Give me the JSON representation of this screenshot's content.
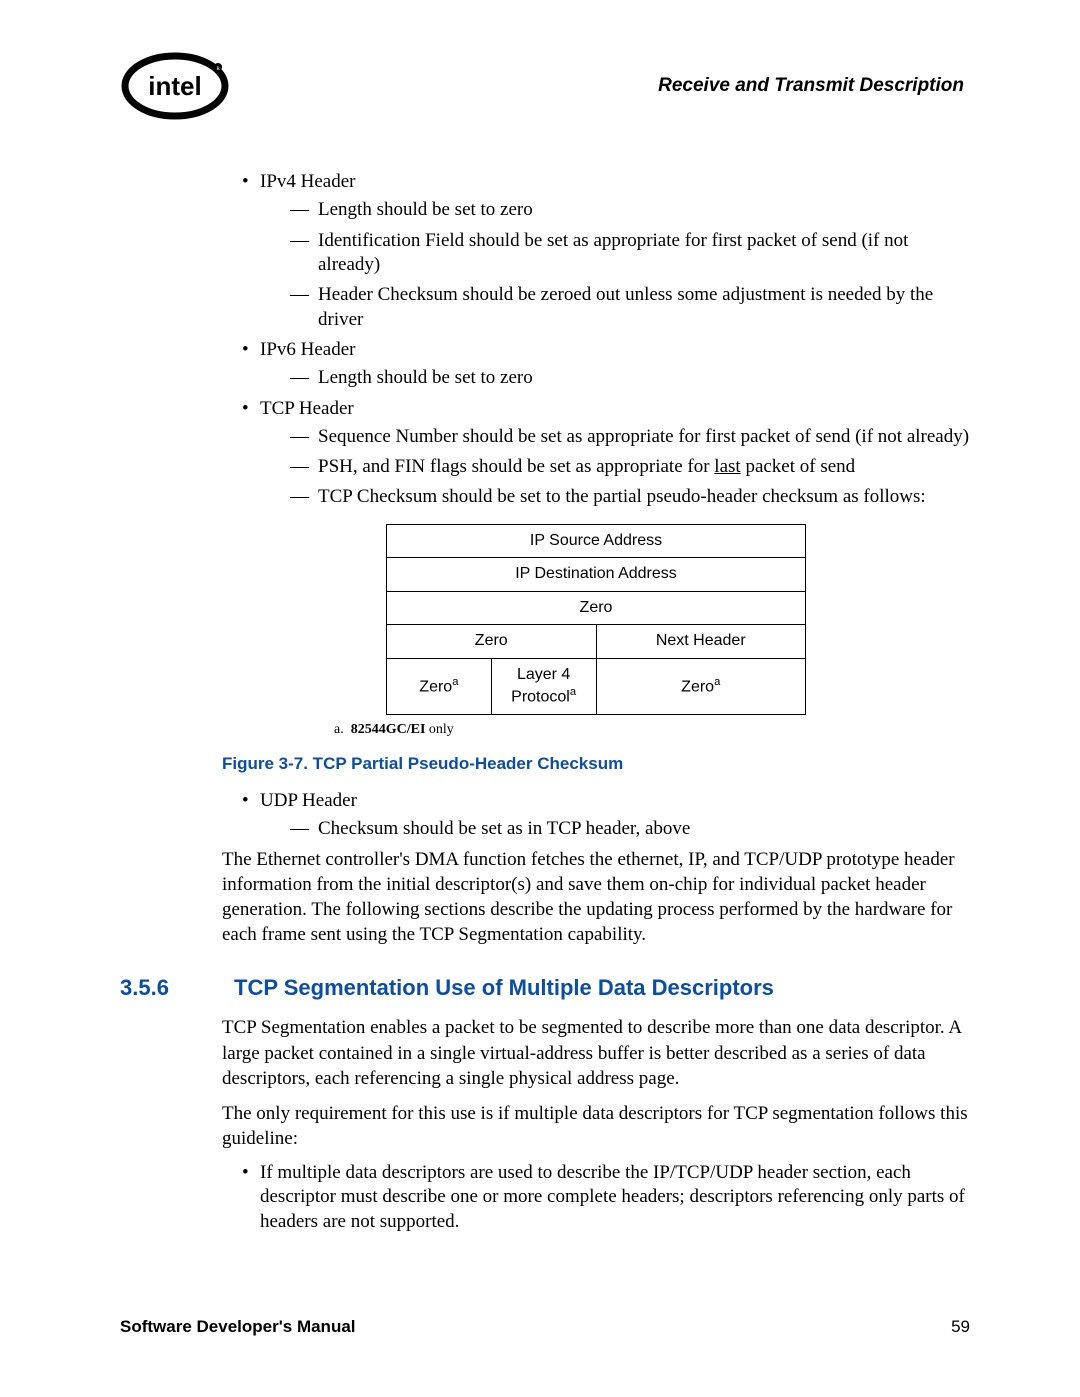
{
  "header": {
    "title": "Receive and Transmit Description"
  },
  "bullets_a": {
    "ipv4": {
      "label": "IPv4 Header",
      "items": [
        "Length should be set to zero",
        "Identification Field should be set as appropriate for first packet of send (if not already)",
        "Header Checksum should be zeroed out unless some adjustment is needed by the driver"
      ]
    },
    "ipv6": {
      "label": "IPv6 Header",
      "items": [
        "Length should be set to zero"
      ]
    },
    "tcp": {
      "label": "TCP Header",
      "items": [
        "Sequence Number should be set as appropriate for first packet of send (if not already)",
        "",
        "TCP Checksum should be set to the partial pseudo-header checksum as follows:"
      ],
      "psh_prefix": "PSH, and FIN flags should be set as appropriate for ",
      "psh_underlined": "last",
      "psh_suffix": " packet of send"
    }
  },
  "table": {
    "r1": "IP Source Address",
    "r2": "IP Destination Address",
    "r3": "Zero",
    "r4a": "Zero",
    "r4b": "Next Header",
    "r5a": "Zero",
    "r5a_sup": "a",
    "r5b_line1": "Layer 4",
    "r5b_line2": "Protocol",
    "r5b_sup": "a",
    "r5c": "Zero",
    "r5c_sup": "a"
  },
  "footnote": {
    "marker": "a.",
    "text": "82544GC/EI",
    "tail": " only"
  },
  "figure": {
    "caption": "Figure 3-7. TCP Partial Pseudo-Header Checksum"
  },
  "bullets_b": {
    "udp": {
      "label": "UDP Header",
      "items": [
        "Checksum should be set as in TCP header, above"
      ]
    }
  },
  "para1": "The Ethernet controller's DMA function fetches the ethernet, IP, and TCP/UDP prototype header information from the initial descriptor(s) and save them on-chip for individual packet header generation. The following sections describe the updating process performed by the hardware for each frame sent using the TCP Segmentation capability.",
  "section": {
    "num": "3.5.6",
    "title": "TCP Segmentation Use of Multiple Data Descriptors"
  },
  "para2": "TCP Segmentation enables a packet to be segmented to describe more than one data descriptor.   A large packet contained in a single virtual-address buffer is better described as a series of data descriptors, each referencing a single physical address page.",
  "para3": "The only requirement for this use is if multiple data descriptors for TCP segmentation follows this guideline:",
  "bullets_c": {
    "item": "If multiple data descriptors are used to describe the IP/TCP/UDP header section, each descriptor must describe one or more complete headers; descriptors referencing only parts of headers are not supported."
  },
  "footer": {
    "left": "Software Developer's Manual",
    "right": "59"
  }
}
